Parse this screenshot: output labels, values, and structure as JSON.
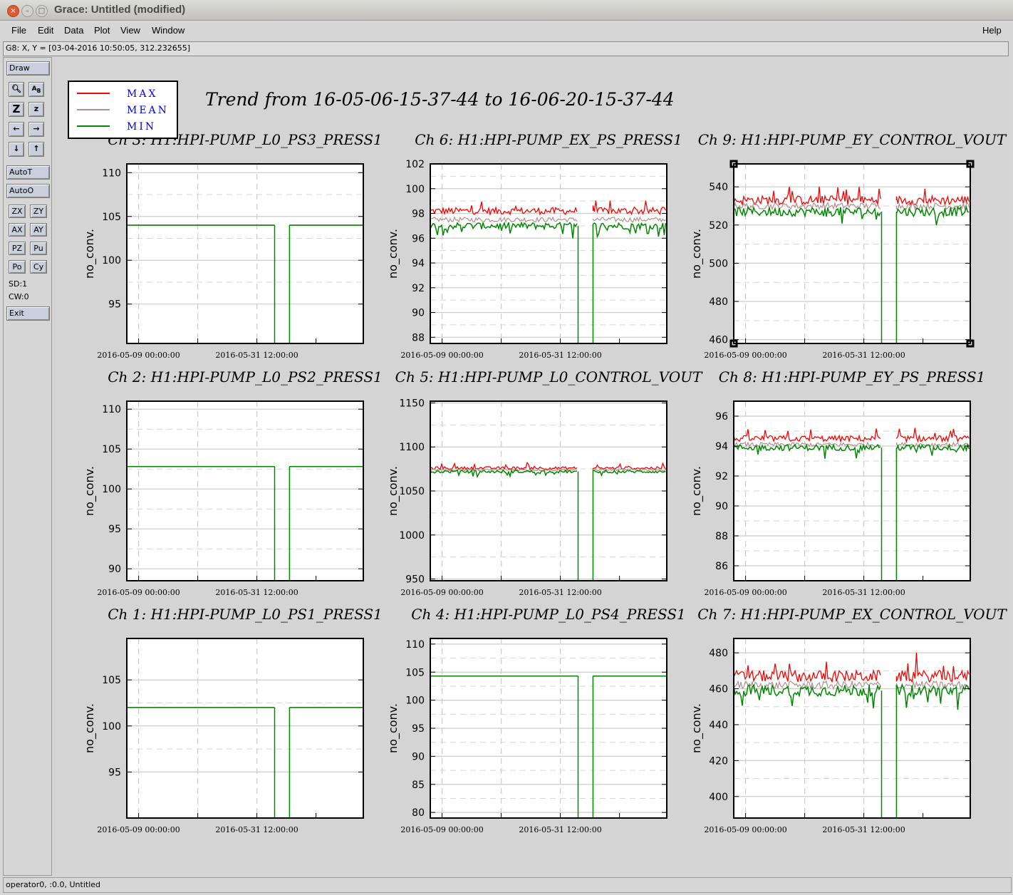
{
  "window": {
    "title": "Grace: Untitled (modified)",
    "close_glyph": "×",
    "min_glyph": "–",
    "max_glyph": "□"
  },
  "menu": {
    "items": [
      "File",
      "Edit",
      "Data",
      "Plot",
      "View",
      "Window"
    ],
    "help": "Help"
  },
  "coord_readout": "G8: X, Y = [03-04-2016 10:50:05, 312.232655]",
  "toolbar": {
    "draw": "Draw",
    "autot": "AutoT",
    "autoo": "AutoO",
    "zx": "ZX",
    "zy": "ZY",
    "ax": "AX",
    "ay": "AY",
    "pz": "PZ",
    "pu": "Pu",
    "po": "Po",
    "cy": "Cy",
    "sd": "SD:1",
    "cw": "CW:0",
    "exit": "Exit",
    "icons": [
      "zoom-icon",
      "autoscale-text-icon",
      "zoom-z-icon",
      "zoom-small-z-icon",
      "left-arrow-icon",
      "right-arrow-icon",
      "down-arrow-icon",
      "up-arrow-icon"
    ]
  },
  "status": "operator0, :0.0, Untitled",
  "colors": {
    "max": "#ff0000",
    "mean": "#b09090",
    "min": "#008800"
  },
  "chart_data": {
    "type": "line",
    "title": "Trend from 16-05-06-15-37-44 to 16-06-20-15-37-44",
    "legend": [
      "MAX",
      "MEAN",
      "MIN"
    ],
    "legend_position": "top-left",
    "xlabel": "",
    "xtick_labels": [
      "2016-05-09 00:00:00",
      "2016-05-31 12:00:00"
    ],
    "ylabel": "no_conv.",
    "grid": true,
    "gap": [
      "2016-06-05",
      "2016-06-06"
    ],
    "panels": [
      {
        "title": "Ch 3: H1:HPI-PUMP_L0_PS3_PRESS1",
        "ylim": [
          90.5,
          111
        ],
        "yticks": [
          95,
          100,
          105,
          110
        ],
        "max": 104,
        "mean": 104,
        "min": 104,
        "noise": 0,
        "selected": false
      },
      {
        "title": "Ch 6: H1:HPI-PUMP_EX_PS_PRESS1",
        "ylim": [
          87.5,
          102
        ],
        "yticks": [
          88,
          90,
          92,
          94,
          96,
          98,
          100,
          102
        ],
        "max": 98.2,
        "mean": 97.5,
        "min": 97,
        "noise": 0.35,
        "selected": false
      },
      {
        "title": "Ch 9: H1:HPI-PUMP_EY_CONTROL_VOUT",
        "ylim": [
          458,
          552
        ],
        "yticks": [
          460,
          480,
          500,
          520,
          540
        ],
        "max": 533,
        "mean": 530,
        "min": 527,
        "noise": 3,
        "selected": true
      },
      {
        "title": "Ch 2: H1:HPI-PUMP_L0_PS2_PRESS1",
        "ylim": [
          88.5,
          111
        ],
        "yticks": [
          90,
          95,
          100,
          105,
          110
        ],
        "max": 102.8,
        "mean": 102.8,
        "min": 102.8,
        "noise": 0,
        "selected": false
      },
      {
        "title": "Ch 5: H1:HPI-PUMP_L0_CONTROL_VOUT",
        "ylim": [
          948,
          1152
        ],
        "yticks": [
          950,
          1000,
          1050,
          1100,
          1150
        ],
        "max": 1076,
        "mean": 1074,
        "min": 1072,
        "noise": 2,
        "selected": false
      },
      {
        "title": "Ch 8: H1:HPI-PUMP_EY_PS_PRESS1",
        "ylim": [
          85,
          97
        ],
        "yticks": [
          86,
          88,
          90,
          92,
          94,
          96
        ],
        "max": 94.5,
        "mean": 94.1,
        "min": 93.9,
        "noise": 0.25,
        "selected": false
      },
      {
        "title": "Ch 1: H1:HPI-PUMP_L0_PS1_PRESS1",
        "ylim": [
          90,
          109.5
        ],
        "yticks": [
          95,
          100,
          105
        ],
        "max": 102,
        "mean": 102,
        "min": 102,
        "noise": 0,
        "selected": false
      },
      {
        "title": "Ch 4: H1:HPI-PUMP_L0_PS4_PRESS1",
        "ylim": [
          79,
          111
        ],
        "yticks": [
          80,
          85,
          90,
          95,
          100,
          105,
          110
        ],
        "max": 104.3,
        "mean": 104.3,
        "min": 104.3,
        "noise": 0,
        "selected": false
      },
      {
        "title": "Ch 7: H1:HPI-PUMP_EX_CONTROL_VOUT",
        "ylim": [
          388,
          488
        ],
        "yticks": [
          400,
          420,
          440,
          460,
          480
        ],
        "max": 467,
        "mean": 462,
        "min": 459,
        "noise": 4,
        "selected": false
      }
    ]
  }
}
